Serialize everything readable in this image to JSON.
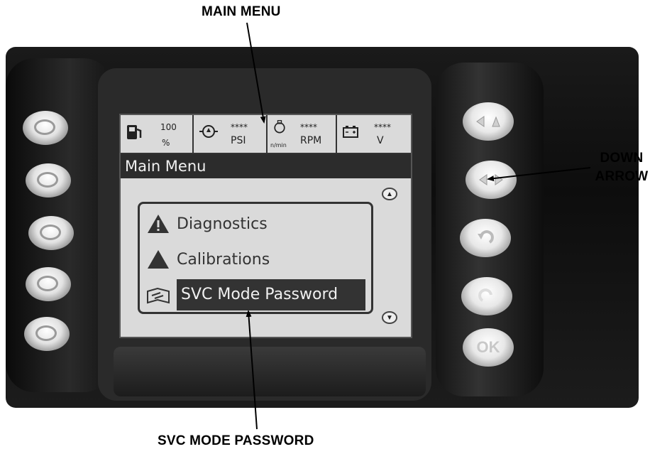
{
  "callouts": {
    "main_menu": "MAIN MENU",
    "down_arrow_line1": "DOWN",
    "down_arrow_line2": "ARROW",
    "svc_mode_password": "SVC MODE PASSWORD"
  },
  "status_bar": {
    "fuel": {
      "icon": "fuel-pump-icon",
      "value": "100",
      "unit": "%"
    },
    "oil_pressure": {
      "icon": "oil-pressure-icon",
      "value": "****",
      "unit": "PSI"
    },
    "engine_speed": {
      "icon": "engine-icon",
      "value": "****",
      "small": "n/min",
      "unit": "RPM"
    },
    "battery": {
      "icon": "battery-icon",
      "value": "****",
      "unit": "V"
    }
  },
  "screen": {
    "title": "Main Menu",
    "menu_items": [
      {
        "label": "Diagnostics",
        "icon": "warning-icon",
        "selected": false
      },
      {
        "label": "Calibrations",
        "icon": "triangle-icon",
        "selected": false
      },
      {
        "label": "SVC Mode Password",
        "icon": "service-manual-icon",
        "selected": true
      }
    ]
  },
  "right_buttons": {
    "ok_label": "OK"
  }
}
